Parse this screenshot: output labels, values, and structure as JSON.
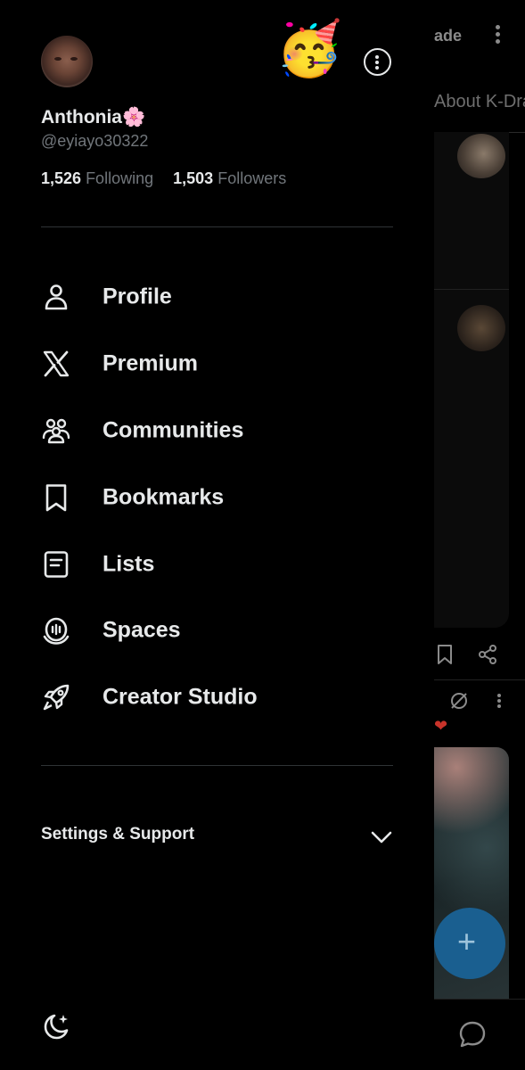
{
  "profile": {
    "display_name": "Anthonia🌸",
    "handle": "@eyiayo30322",
    "following_count": "1,526",
    "following_label": "Following",
    "followers_count": "1,503",
    "followers_label": "Followers",
    "header_emoji": "🥳"
  },
  "menu": {
    "items": [
      {
        "label": "Profile",
        "icon": "person-icon"
      },
      {
        "label": "Premium",
        "icon": "x-logo-icon"
      },
      {
        "label": "Communities",
        "icon": "communities-icon"
      },
      {
        "label": "Bookmarks",
        "icon": "bookmark-icon"
      },
      {
        "label": "Lists",
        "icon": "list-icon"
      },
      {
        "label": "Spaces",
        "icon": "spaces-icon"
      },
      {
        "label": "Creator Studio",
        "icon": "rocket-icon"
      }
    ]
  },
  "settings": {
    "label": "Settings & Support",
    "icon": "chevron-down-icon"
  },
  "background": {
    "upgrade_text": "ade",
    "tab_text": "About K-Dra",
    "fab_icon": "+"
  },
  "colors": {
    "background": "#000000",
    "text_primary": "#e7e9ea",
    "text_secondary": "#71767b",
    "divider": "#2f3336",
    "fab": "#1a5f90"
  }
}
